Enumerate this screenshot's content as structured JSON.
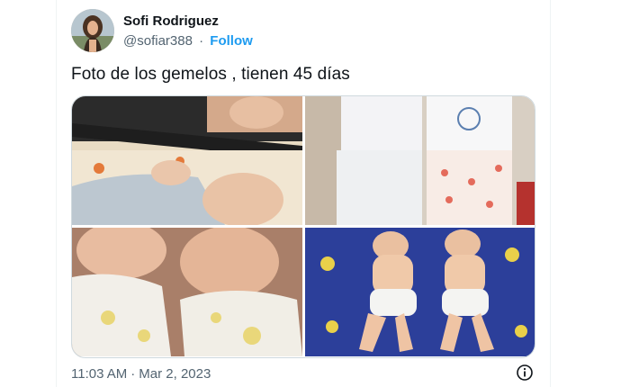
{
  "tweet": {
    "author_name": "Sofi Rodriguez",
    "handle": "@sofiar388",
    "separator": "·",
    "follow_label": "Follow",
    "text": "Foto de los gemelos , tienen 45 días",
    "time": "11:03 AM",
    "date": "Mar 2, 2023",
    "time_separator": "·"
  },
  "media": [
    {
      "icon": "photo-babies-in-stroller"
    },
    {
      "icon": "photo-babies-in-bodysuits"
    },
    {
      "icon": "photo-babies-faces-closeup"
    },
    {
      "icon": "photo-babies-on-blue-blanket"
    }
  ],
  "colors": {
    "text": "#0f1419",
    "secondary": "#536471",
    "link": "#1d9bf0",
    "border": "#cfd9de"
  }
}
